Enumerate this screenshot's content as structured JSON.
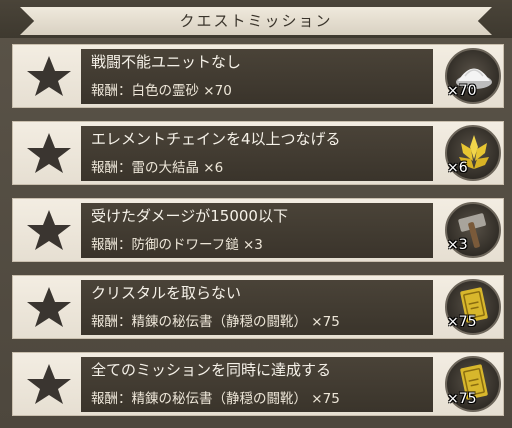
{
  "header": {
    "title": "クエストミッション"
  },
  "missions": [
    {
      "title": "戦闘不能ユニットなし",
      "reward": "報酬：白色の霊砂 ×70",
      "count": "×70",
      "icon": "white-sand-icon"
    },
    {
      "title": "エレメントチェインを4以上つなげる",
      "reward": "報酬：雷の大結晶 ×6",
      "count": "×6",
      "icon": "thunder-crystal-icon"
    },
    {
      "title": "受けたダメージが15000以下",
      "reward": "報酬：防御のドワーフ鎚 ×3",
      "count": "×3",
      "icon": "dwarf-hammer-icon"
    },
    {
      "title": "クリスタルを取らない",
      "reward": "報酬：精錬の秘伝書（静穏の闘靴） ×75",
      "count": "×75",
      "icon": "secret-book-icon"
    },
    {
      "title": "全てのミッションを同時に達成する",
      "reward": "報酬：精錬の秘伝書（静穏の闘靴） ×75",
      "count": "×75",
      "icon": "secret-book-icon"
    }
  ],
  "colors": {
    "panel": "#ece5d8",
    "text_bar": "#3f392f",
    "star": "#3a3530"
  }
}
